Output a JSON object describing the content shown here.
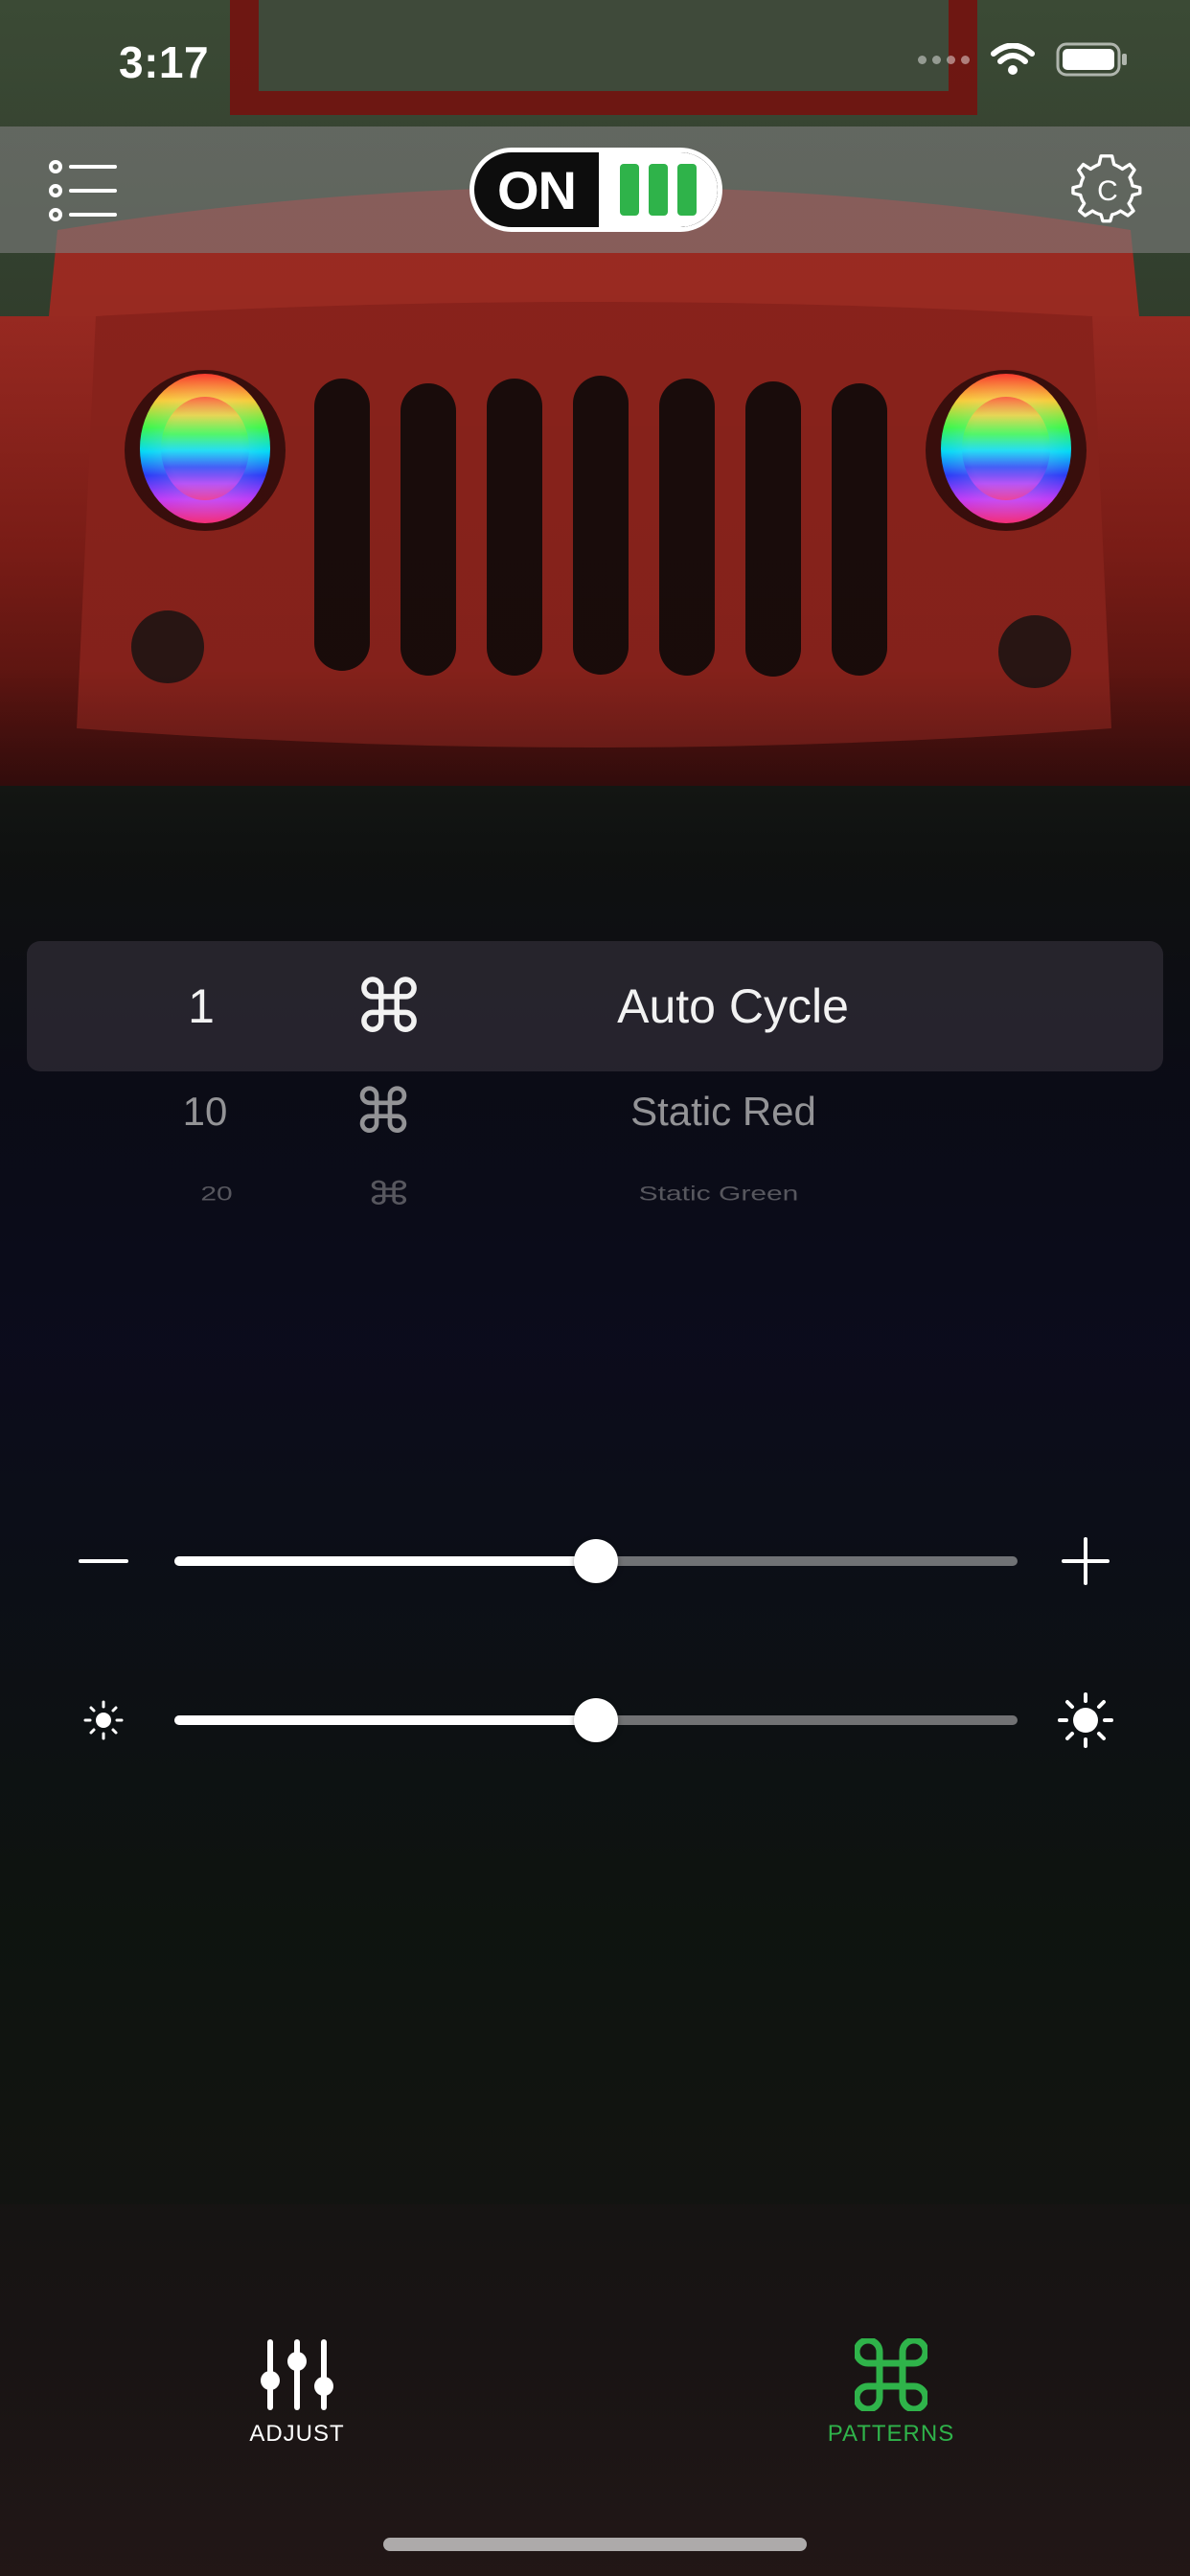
{
  "status_bar": {
    "time": "3:17",
    "signal_icon": "cellular-signal-icon",
    "wifi_icon": "wifi-icon",
    "battery_icon": "battery-icon",
    "battery_level": 1.0
  },
  "nav": {
    "menu_icon": "list-menu-icon",
    "power_toggle_label": "ON",
    "power_state": "on",
    "settings_icon": "gear-c-icon"
  },
  "patterns": {
    "selected_index": 0,
    "items": [
      {
        "number": "1",
        "symbol": "⌘",
        "name": "Auto Cycle"
      },
      {
        "number": "10",
        "symbol": "⌘",
        "name": "Static Red"
      },
      {
        "number": "20",
        "symbol": "⌘",
        "name": "Static Green"
      }
    ]
  },
  "sliders": {
    "speed": {
      "value": 0.5,
      "min_icon": "minus-icon",
      "max_icon": "plus-icon"
    },
    "brightness": {
      "value": 0.5,
      "min_icon": "sun-small-icon",
      "max_icon": "sun-large-icon"
    }
  },
  "tabs": [
    {
      "label": "ADJUST",
      "icon": "sliders-icon",
      "active": false
    },
    {
      "label": "PATTERNS",
      "icon": "command-icon",
      "active": true
    }
  ],
  "colors": {
    "accent_green": "#2fb34a",
    "nav_bar": "#7d7d7d",
    "jeep_red": "#8a1c16"
  }
}
